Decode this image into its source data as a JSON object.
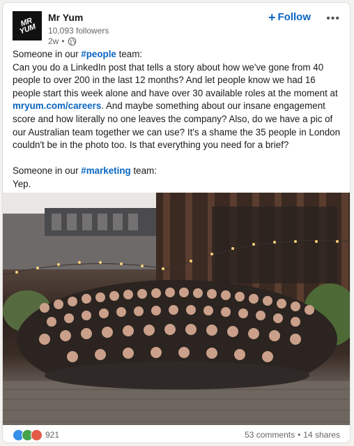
{
  "post": {
    "author": "Mr Yum",
    "logo_text_line1": "MR",
    "logo_text_line2": "YUM",
    "followers": "10,093 followers",
    "age": "2w",
    "dot": "•",
    "follow_label": "Follow",
    "follow_plus": "+",
    "more_label": "•••"
  },
  "text": {
    "line1_prefix": "Someone in our ",
    "line1_tag": "#people",
    "line1_suffix": " team:",
    "para_a": "Can you do a LinkedIn post that tells a story about how we've gone from 40 people to over 200 in the last 12 months? And let people know we had 16 people start this week alone and have over 30 available roles at the moment at ",
    "para_link": "mryum.com/careers",
    "para_b": ". And maybe something about our insane engagement score and how literally no one leaves the company? Also, do we have a pic of our Australian team together we can use? It's a shame the 35 people in London couldn't be in the photo too. Is that everything you need for a brief?",
    "line2_prefix": "Someone in our ",
    "line2_tag": "#marketing",
    "line2_suffix": " team:",
    "reply": "Yep."
  },
  "footer": {
    "reaction_count": "921",
    "comments": "53 comments",
    "dot": "•",
    "shares": "14 shares"
  },
  "colors": {
    "accent": "#0a66c2",
    "like": "#378fe9",
    "celebrate": "#44a34b",
    "love": "#e25b47"
  }
}
